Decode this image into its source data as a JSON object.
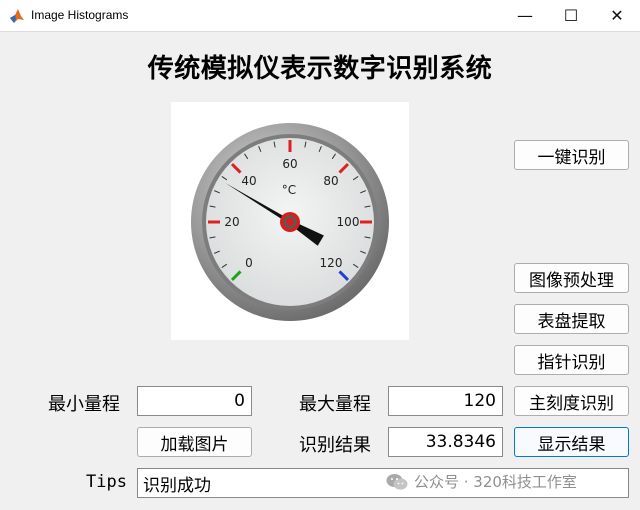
{
  "window": {
    "title": "Image Histograms",
    "minimize": "—",
    "maximize": "☐",
    "close": "✕"
  },
  "heading": "传统模拟仪表示数字识别系统",
  "gauge": {
    "unit": "°C",
    "scale_labels": [
      "0",
      "20",
      "40",
      "60",
      "80",
      "100",
      "120"
    ],
    "min": 0,
    "max": 120,
    "needle_value": 33.8346,
    "colors": {
      "face": "#e6e8e8",
      "bezel": "#8c8c8c",
      "needle": "#111111",
      "hub": "#d62020",
      "marks_red": "#e02020",
      "mark_green": "#1aa51a",
      "mark_blue": "#1f3fd8"
    }
  },
  "buttons": {
    "one_click": "一键识别",
    "preprocess": "图像预处理",
    "dial_extract": "表盘提取",
    "pointer_recog": "指针识别",
    "main_scale_recog": "主刻度识别",
    "load_image": "加载图片",
    "show_result": "显示结果"
  },
  "fields": {
    "min_range_label": "最小量程",
    "min_range_value": "0",
    "max_range_label": "最大量程",
    "max_range_value": "120",
    "result_label": "识别结果",
    "result_value": "33.8346",
    "tips_label": "Tips",
    "tips_value": "识别成功"
  },
  "watermark": {
    "text": "公众号 · 320科技工作室",
    "icon": "wechat-icon"
  }
}
